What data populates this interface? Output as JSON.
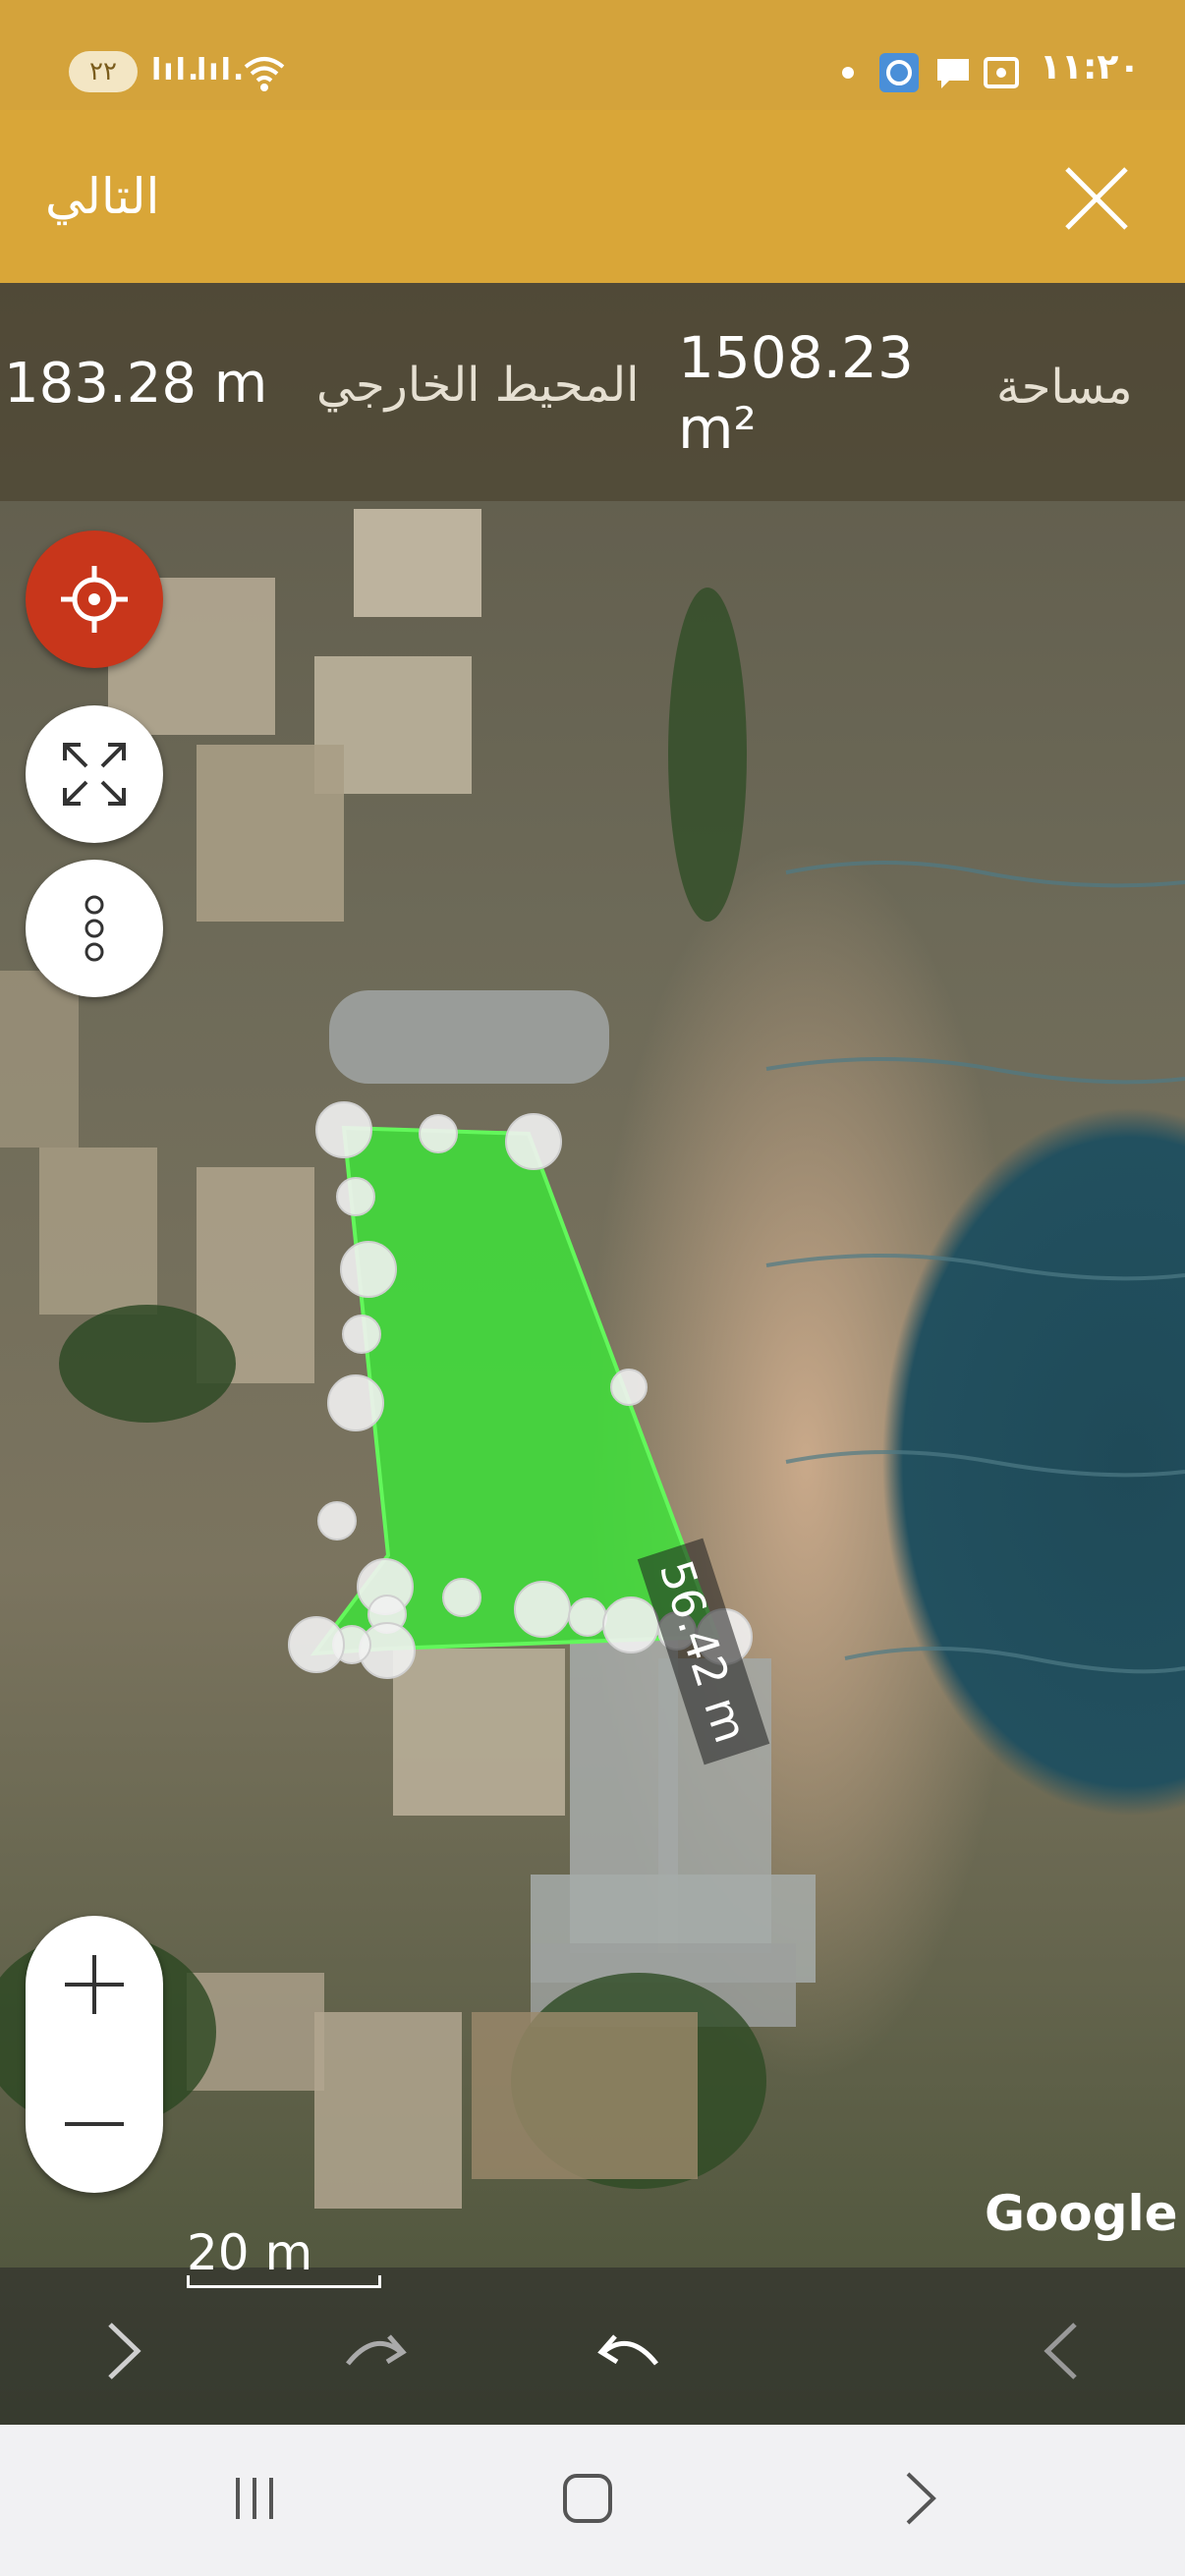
{
  "status_bar": {
    "battery": "٢٢",
    "signal_1": "lıl.",
    "signal_2": "lıl.",
    "time": "١١:٢٠"
  },
  "app_bar": {
    "next_label": "التالي",
    "close_icon": "close-icon"
  },
  "measure": {
    "perimeter_value": "183.28 m",
    "perimeter_label": "المحيط الخارجي",
    "area_value": "1508.23 m²",
    "area_label": "مساحة",
    "segment_length": "56.42 m"
  },
  "map": {
    "scale_label": "20 m",
    "attribution": "Google",
    "polygon_color": "#3ee23a"
  },
  "icons": {
    "location": "crosshair-icon",
    "expand": "expand-icon",
    "more": "more-vertical-icon",
    "zoom_in": "plus-icon",
    "zoom_out": "minus-icon",
    "next": "chevron-right-icon",
    "redo": "redo-icon",
    "undo": "undo-icon",
    "prev": "chevron-left-icon"
  },
  "nav_bar": {
    "recent": "recents-icon",
    "home": "home-icon",
    "back": "back-icon"
  },
  "colors": {
    "accent": "#d9a638",
    "location_button": "#c8361b"
  }
}
